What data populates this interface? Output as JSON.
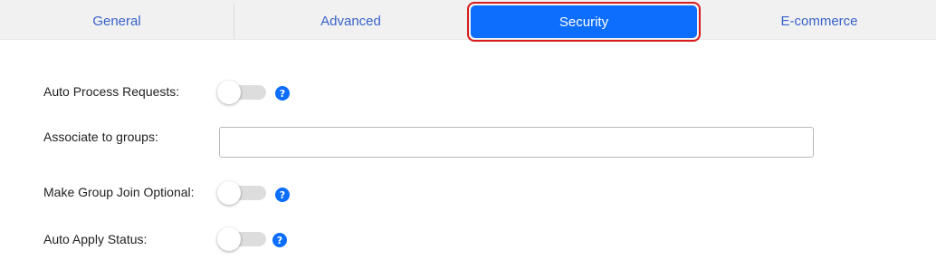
{
  "tabs": {
    "general": "General",
    "advanced": "Advanced",
    "security": "Security",
    "ecommerce": "E-commerce",
    "active": "Security"
  },
  "colors": {
    "accent": "#0d6efd",
    "highlight_ring": "#d71d1d",
    "tab_text": "#3a62c9"
  },
  "form": {
    "auto_process_requests": {
      "label": "Auto Process Requests:",
      "enabled": false,
      "help_icon": "question-circle-icon",
      "help_glyph": "?"
    },
    "associate_to_groups": {
      "label": "Associate to groups:",
      "value": "",
      "placeholder": ""
    },
    "make_group_join_optional": {
      "label": "Make Group Join Optional:",
      "enabled": false,
      "help_icon": "question-circle-icon",
      "help_glyph": "?"
    },
    "auto_apply_status": {
      "label": "Auto Apply Status:",
      "enabled": false,
      "help_icon": "question-circle-icon",
      "help_glyph": "?"
    }
  }
}
